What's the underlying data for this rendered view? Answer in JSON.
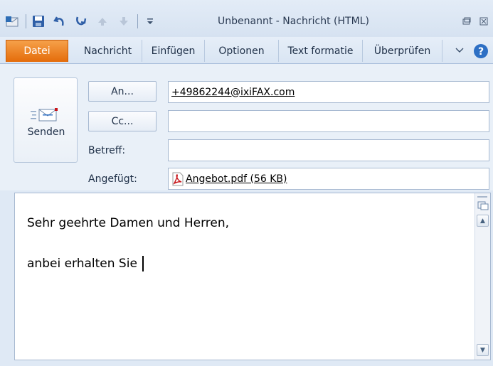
{
  "window": {
    "title": "Unbenannt - Nachricht (HTML)",
    "qat_icons": [
      "outlook-icon",
      "save-icon",
      "undo-icon",
      "redo-icon",
      "up-icon",
      "down-icon",
      "customize-icon"
    ]
  },
  "ribbon": {
    "file_tab": "Datei",
    "tabs": [
      "Nachricht",
      "Einfügen",
      "Optionen",
      "Text formatie",
      "Überprüfen"
    ]
  },
  "compose": {
    "send_label": "Senden",
    "to_button": "An...",
    "cc_button": "Cc...",
    "subject_label": "Betreff:",
    "attached_label": "Angefügt:",
    "to_value": "+49862244@ixiFAX.com",
    "cc_value": "",
    "subject_value": "",
    "attachment": "Angebot.pdf (56 KB)"
  },
  "body": {
    "line1": "Sehr geehrte Damen und Herren,",
    "line2": "anbei erhalten Sie "
  },
  "colors": {
    "file_tab": "#e46c0a",
    "pdf_red": "#c8151a"
  }
}
